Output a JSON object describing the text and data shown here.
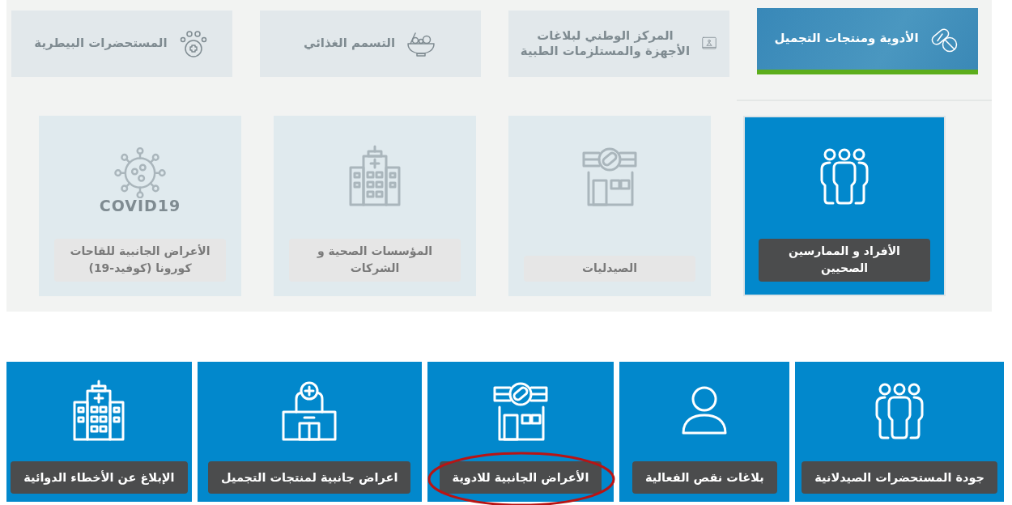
{
  "tabs": [
    {
      "label": "الأدوية ومنتجات التجميل",
      "kind": "pills",
      "selected": true
    },
    {
      "label": "المركز الوطني لبلاغات الأجهزة والمستلزمات الطبية",
      "kind": "device",
      "selected": false
    },
    {
      "label": "التسمم الغذائي",
      "kind": "bowl",
      "selected": false
    },
    {
      "label": "المستحضرات البيطرية",
      "kind": "paw",
      "selected": false
    }
  ],
  "categories": [
    {
      "label": "الأفراد و الممارسين الصحيين",
      "kind": "people",
      "selected": true
    },
    {
      "label": "الصيدليات",
      "kind": "pharmacy",
      "selected": false
    },
    {
      "label": "المؤسسات الصحية و الشركات",
      "kind": "hospital",
      "selected": false
    },
    {
      "label": "الأعراض الجانبية للقاحات كورونا (كوفيد-19)",
      "kind": "virus",
      "icon_text": "COVID19",
      "selected": false
    }
  ],
  "services": [
    {
      "label": "جودة المستحضرات الصيدلانية",
      "kind": "people",
      "circled": false
    },
    {
      "label": "بلاغات نقص الفعالية",
      "kind": "person",
      "circled": false
    },
    {
      "label": "الأعراض الجانبية للادوية",
      "kind": "pharmacy",
      "circled": true
    },
    {
      "label": "اعراض جانبية لمنتجات التجميل",
      "kind": "clinic",
      "circled": false
    },
    {
      "label": "الإبلاغ عن الأخطاء الدوائية",
      "kind": "hospital",
      "circled": false
    }
  ]
}
